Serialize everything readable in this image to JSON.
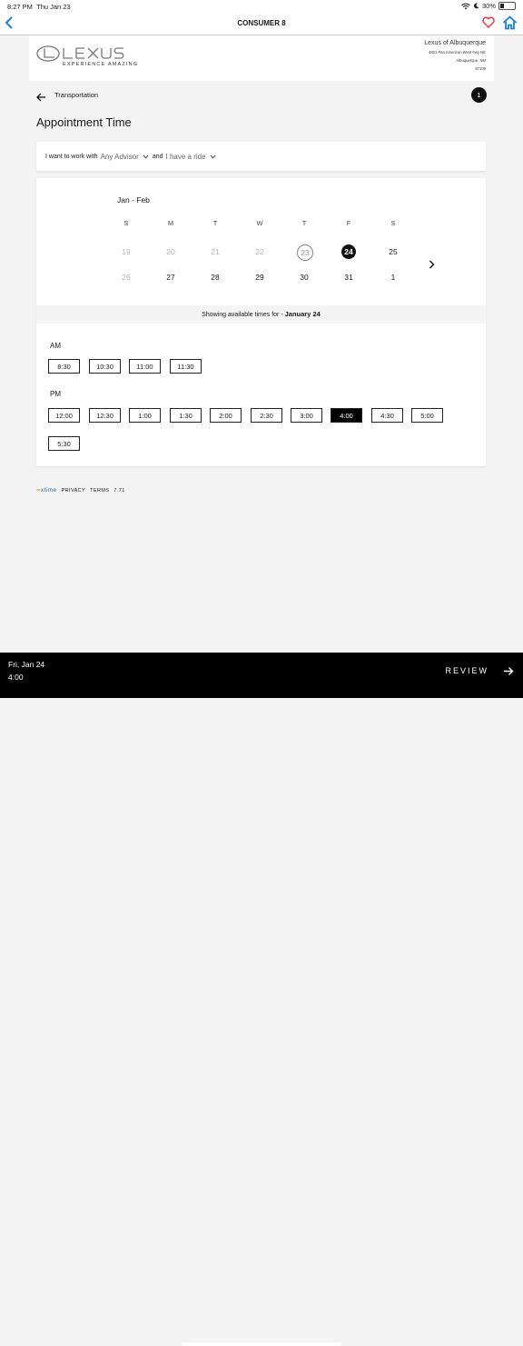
{
  "status": {
    "time": "8:27 PM",
    "date": "Thu Jan 23",
    "battery": "30%",
    "battery_level": 0.3
  },
  "nav": {
    "title": "CONSUMER 8"
  },
  "dealer": {
    "brand_tagline": "EXPERIENCE AMAZING",
    "name": "Lexus of Albuquerque",
    "address": "4821 Pan American West Fwy NE",
    "city": "Albuquerque, NM",
    "zip": "87109"
  },
  "breadcrumb": {
    "label": "Transportation",
    "step": "1"
  },
  "page": {
    "title": "Appointment Time"
  },
  "filter": {
    "prefix": "I want to work with",
    "advisor": "Any Advisor",
    "middle": "and",
    "ride": "I have a ride"
  },
  "calendar": {
    "month_label": "Jan - Feb",
    "weekdays": [
      "S",
      "M",
      "T",
      "W",
      "T",
      "F",
      "S"
    ],
    "weeks": [
      [
        {
          "d": "19",
          "s": "past"
        },
        {
          "d": "20",
          "s": "past"
        },
        {
          "d": "21",
          "s": "past"
        },
        {
          "d": "22",
          "s": "past"
        },
        {
          "d": "23",
          "s": "today"
        },
        {
          "d": "24",
          "s": "selected"
        },
        {
          "d": "25",
          "s": "avail"
        }
      ],
      [
        {
          "d": "26",
          "s": "past"
        },
        {
          "d": "27",
          "s": "avail"
        },
        {
          "d": "28",
          "s": "avail"
        },
        {
          "d": "29",
          "s": "avail"
        },
        {
          "d": "30",
          "s": "avail"
        },
        {
          "d": "31",
          "s": "avail"
        },
        {
          "d": "1",
          "s": "avail"
        }
      ]
    ]
  },
  "showing": {
    "prefix": "Showing available times for -",
    "date": "January 24"
  },
  "times": {
    "am_label": "AM",
    "am": [
      "8:30",
      "10:30",
      "11:00",
      "11:30"
    ],
    "pm_label": "PM",
    "pm": [
      "12:00",
      "12:30",
      "1:00",
      "1:30",
      "2:00",
      "2:30",
      "3:00",
      "4:00",
      "4:30",
      "5:00",
      "5:30"
    ],
    "selected": "4:00"
  },
  "footer": {
    "brand_a": "∞",
    "brand_b": "xtime",
    "privacy": "PRIVACY",
    "terms": "TERMS",
    "version": "7.71"
  },
  "bottom": {
    "date": "Fri, Jan 24",
    "time": "4:00",
    "review": "REVIEW"
  },
  "colors": {
    "accent": "#1a7fd9",
    "heart": "#e0323f",
    "selected": "#000000"
  }
}
